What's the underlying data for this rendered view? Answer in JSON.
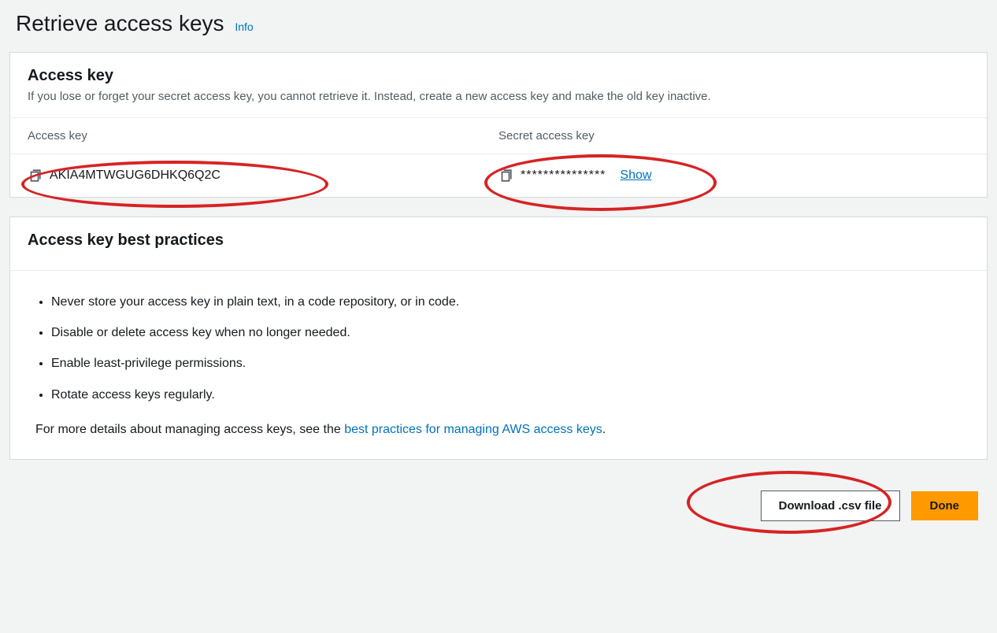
{
  "page": {
    "title": "Retrieve access keys",
    "info": "Info"
  },
  "panel1": {
    "title": "Access key",
    "desc": "If you lose or forget your secret access key, you cannot retrieve it. Instead, create a new access key and make the old key inactive.",
    "hdr_access": "Access key",
    "hdr_secret": "Secret access key",
    "access_key": "AKIA4MTWGUG6DHKQ6Q2C",
    "secret_masked": "***************",
    "show_label": "Show"
  },
  "panel2": {
    "title": "Access key best practices",
    "items": [
      "Never store your access key in plain text, in a code repository, or in code.",
      "Disable or delete access key when no longer needed.",
      "Enable least-privilege permissions.",
      "Rotate access keys regularly."
    ],
    "more_pre": "For more details about managing access keys, see the ",
    "more_link": "best practices for managing AWS access keys",
    "more_post": "."
  },
  "actions": {
    "download": "Download .csv file",
    "done": "Done"
  }
}
